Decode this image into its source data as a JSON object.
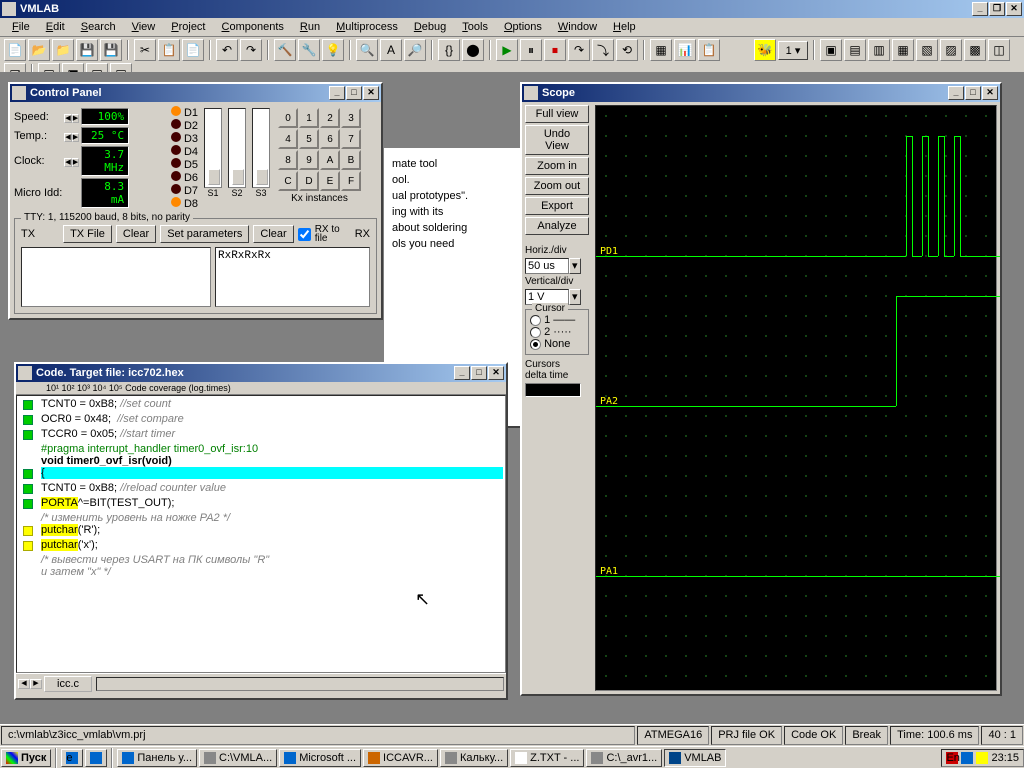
{
  "app": {
    "title": "VMLAB"
  },
  "menus": [
    "File",
    "Edit",
    "Search",
    "View",
    "Project",
    "Components",
    "Run",
    "Multiprocess",
    "Debug",
    "Tools",
    "Options",
    "Window",
    "Help"
  ],
  "control_panel": {
    "title": "Control Panel",
    "speed": {
      "label": "Speed:",
      "value": "100%"
    },
    "temp": {
      "label": "Temp.:",
      "value": "25 °C"
    },
    "clock": {
      "label": "Clock:",
      "value": "3.7 MHz"
    },
    "idd": {
      "label": "Micro Idd:",
      "value": "8.3 mA"
    },
    "leds": [
      "D1",
      "D2",
      "D3",
      "D4",
      "D5",
      "D6",
      "D7",
      "D8"
    ],
    "sliders": [
      "S1",
      "S2",
      "S3"
    ],
    "kx_label": "Kx instances",
    "kx": [
      "0",
      "1",
      "2",
      "3",
      "4",
      "5",
      "6",
      "7",
      "8",
      "9",
      "A",
      "B",
      "C",
      "D",
      "E",
      "F"
    ],
    "tty": {
      "legend": "TTY: 1, 115200 baud, 8 bits, no parity",
      "tx": "TX",
      "txfile": "TX File",
      "clear": "Clear",
      "setparams": "Set parameters",
      "rxclear": "Clear",
      "rxtofile": "RX to file",
      "rxtofile_short": "RX to\nfile",
      "rx": "RX",
      "rx_content": "RxRxRxRx"
    }
  },
  "code_window": {
    "title": "Code. Target file: icc702.hex",
    "ruler": "10¹      10²       10³       10⁴       10⁵      Code coverage (log.times)",
    "tab": "icc.c",
    "lines": [
      {
        "g": "g",
        "text": "TCNT0 = 0xB8; ",
        "comment": "//set count"
      },
      {
        "g": "g",
        "text": "OCR0 = 0x48;  ",
        "comment": "//set compare"
      },
      {
        "g": "g",
        "text": "TCCR0 = 0x05; ",
        "comment": "//start timer"
      },
      {
        "g": "",
        "text": "",
        "comment": ""
      },
      {
        "g": "",
        "dir": "#pragma interrupt_handler timer0_ovf_isr:10"
      },
      {
        "g": "",
        "bold": "void timer0_ovf_isr(void)"
      },
      {
        "g": "g",
        "cyan": "{"
      },
      {
        "g": "g",
        "text": "TCNT0 = 0xB8; ",
        "comment": "//reload counter value"
      },
      {
        "g": "",
        "text": ""
      },
      {
        "g": "g",
        "yl": "PORTA",
        "rest": "^=BIT(TEST_OUT);"
      },
      {
        "g": "",
        "comment": "/* изменить уровень на ножке PA2 */"
      },
      {
        "g": "y",
        "yl": "putchar",
        "rest": "('R');"
      },
      {
        "g": "y",
        "yl": "putchar",
        "rest": "('x');"
      },
      {
        "g": "",
        "comment": "/* вывести через USART на ПК символы \"R\""
      },
      {
        "g": "",
        "comment": "и затем \"x\" */"
      }
    ]
  },
  "scope": {
    "title": "Scope",
    "buttons": {
      "full": "Full view",
      "undo": "Undo View",
      "zin": "Zoom in",
      "zout": "Zoom out",
      "export": "Export",
      "analyze": "Analyze"
    },
    "horiz_label": "Horiz./div",
    "horiz_val": "50 us",
    "vert_label": "Vertical/div",
    "vert_val": "1 V",
    "cursor_legend": "Cursor",
    "cursor_opts": [
      "1 ——",
      "2 ·····",
      "None"
    ],
    "cursor_selected": 2,
    "delta": "Cursors\ndelta time",
    "traces": [
      "PD1",
      "PA2",
      "PA1"
    ]
  },
  "bg_text": [
    "mate tool",
    "",
    "ool.",
    "ual prototypes\".",
    "ing with its",
    " about soldering",
    "",
    "ols you need"
  ],
  "status": {
    "path": "c:\\vmlab\\z3icc_vmlab\\vm.prj",
    "chip": "ATMEGA16",
    "prj": "PRJ file OK",
    "code": "Code OK",
    "state": "Break",
    "time": "Time:   100.6 ms",
    "pos": "40 : 1"
  },
  "taskbar": {
    "start": "Пуск",
    "items": [
      "Панель у...",
      "C:\\VMLA...",
      "Microsoft ...",
      "ICCAVR...",
      "Кальку...",
      "Z.TXT - ...",
      "C:\\_avr1...",
      "VMLAB"
    ],
    "clock": "23:15"
  }
}
